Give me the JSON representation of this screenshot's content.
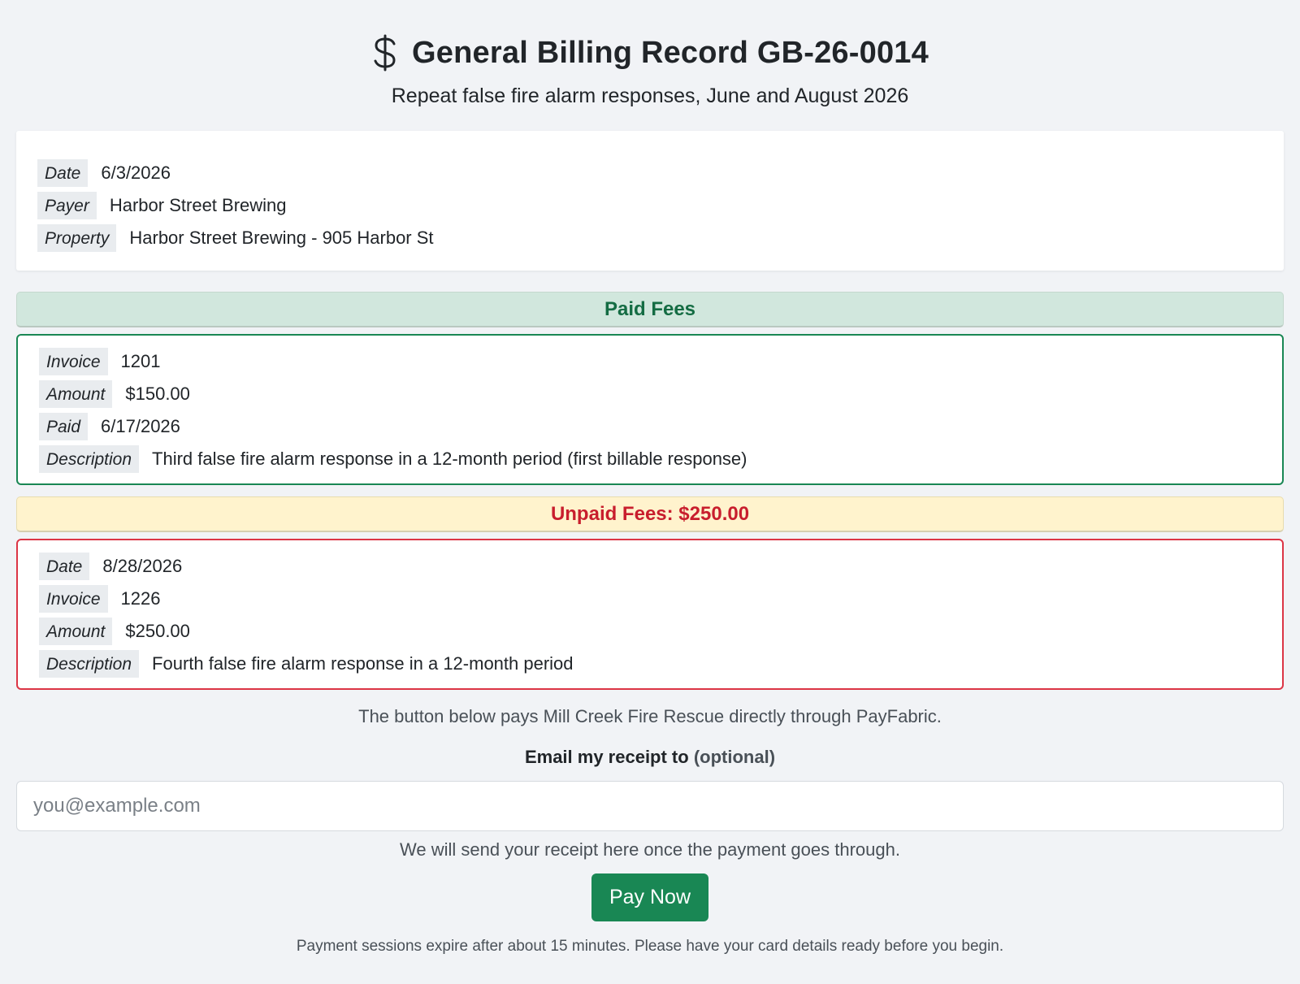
{
  "header": {
    "icon": "dollar-icon",
    "title": "General Billing Record GB-26-0014",
    "subtitle": "Repeat false fire alarm responses, June and August 2026"
  },
  "record": {
    "date_label": "Date",
    "date": "6/3/2026",
    "payer_label": "Payer",
    "payer": "Harbor Street Brewing",
    "property_label": "Property",
    "property": "Harbor Street Brewing - 905 Harbor St"
  },
  "paid": {
    "heading": "Paid Fees",
    "invoice_label": "Invoice",
    "invoice": "1201",
    "amount_label": "Amount",
    "amount": "$150.00",
    "paid_label": "Paid",
    "paid_date": "6/17/2026",
    "description_label": "Description",
    "description": "Third false fire alarm response in a 12-month period (first billable response)"
  },
  "unpaid": {
    "heading": "Unpaid Fees: $250.00",
    "date_label": "Date",
    "date": "8/28/2026",
    "invoice_label": "Invoice",
    "invoice": "1226",
    "amount_label": "Amount",
    "amount": "$250.00",
    "description_label": "Description",
    "description": "Fourth false fire alarm response in a 12-month period"
  },
  "payment": {
    "note": "The button below pays Mill Creek Fire Rescue directly through PayFabric.",
    "email_label": "Email my receipt to",
    "email_optional": "(optional)",
    "email_placeholder": "you@example.com",
    "email_value": "",
    "email_help": "We will send your receipt here once the payment goes through.",
    "pay_button": "Pay Now",
    "footer": "Payment sessions expire after about 15 minutes. Please have your card details ready before you begin."
  },
  "colors": {
    "success": "#198754",
    "danger": "#dc3545",
    "paid_bg": "#d1e7dd",
    "unpaid_bg": "#fff3cd"
  }
}
